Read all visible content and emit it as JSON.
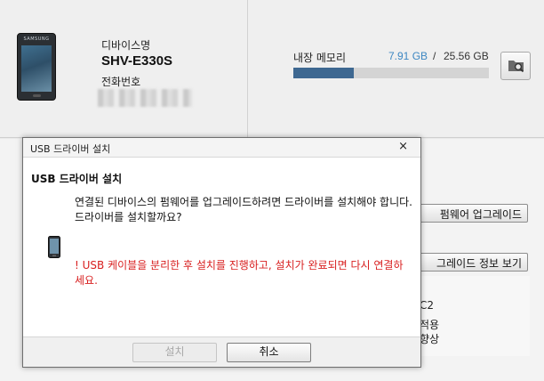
{
  "device": {
    "name_label": "디바이스명",
    "model": "SHV-E330S",
    "phone_label": "전화번호",
    "phone_brand": "SAMSUNG"
  },
  "storage": {
    "label": "내장 메모리",
    "used": "7.91 GB",
    "separator": "/",
    "total": "25.56 GB",
    "used_fraction": 0.309
  },
  "side_panel": {
    "firmware_upgrade_button": "펌웨어 업그레이드",
    "upgrade_info_button": "그레이드 정보 보기",
    "info_lines": [
      "C2",
      "적용",
      "향상"
    ]
  },
  "dialog": {
    "window_title": "USB 드라이버 설치",
    "close_glyph": "×",
    "heading": "USB 드라이버 설치",
    "message": "연결된 디바이스의 펌웨어를 업그레이드하려면 드라이버를 설치해야 합니다.드라이버를 설치할까요?",
    "warning": "! USB 케이블을 분리한 후 설치를 진행하고, 설치가 완료되면 다시 연결하세요.",
    "install_button": "설치",
    "cancel_button": "취소"
  },
  "colors": {
    "storage_used_text": "#3d87c2",
    "storage_bar_fill": "#3e6891",
    "warning_text": "#d81f1f"
  },
  "icons": [
    "phone-icon",
    "folder-search-icon",
    "close-icon",
    "device-icon"
  ]
}
